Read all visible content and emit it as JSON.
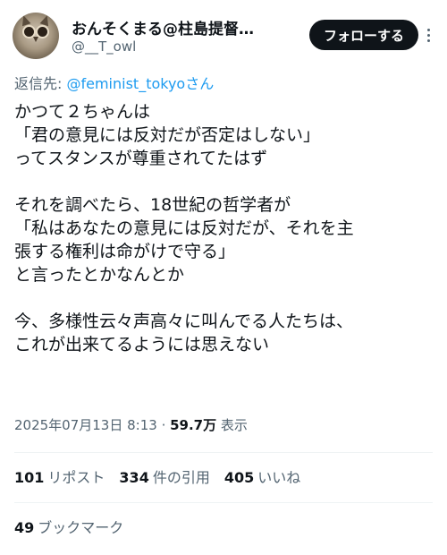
{
  "author": {
    "display_name": "おんそくまる@柱島提督…",
    "handle": "@__T_owl"
  },
  "follow_button": "フォローする",
  "reply_to": {
    "prefix": "返信先: ",
    "mention": "@feminist_tokyo",
    "suffix": "さん"
  },
  "tweet_lines": [
    "かつて２ちゃんは",
    "「君の意見には反対だが否定はしない」",
    "ってスタンスが尊重されてたはず",
    "",
    "それを調べたら、18世紀の哲学者が",
    "「私はあなたの意見には反対だが、それを主",
    "張する権利は命がけで守る」",
    "と言ったとかなんとか",
    "",
    "今、多様性云々声高々に叫んでる人たちは、",
    "これが出来てるようには思えない"
  ],
  "meta": {
    "date_time": "2025年07月13日 8:13 · ",
    "views_count": "59.7万",
    "views_label": " 表示"
  },
  "stats": {
    "reposts_count": "101",
    "reposts_label": "リポスト",
    "quotes_count": "334",
    "quotes_label": "件の引用",
    "likes_count": "405",
    "likes_label": "いいね",
    "bookmarks_count": "49",
    "bookmarks_label": "ブックマーク"
  },
  "icons": [
    "owl-avatar",
    "more-icon"
  ]
}
